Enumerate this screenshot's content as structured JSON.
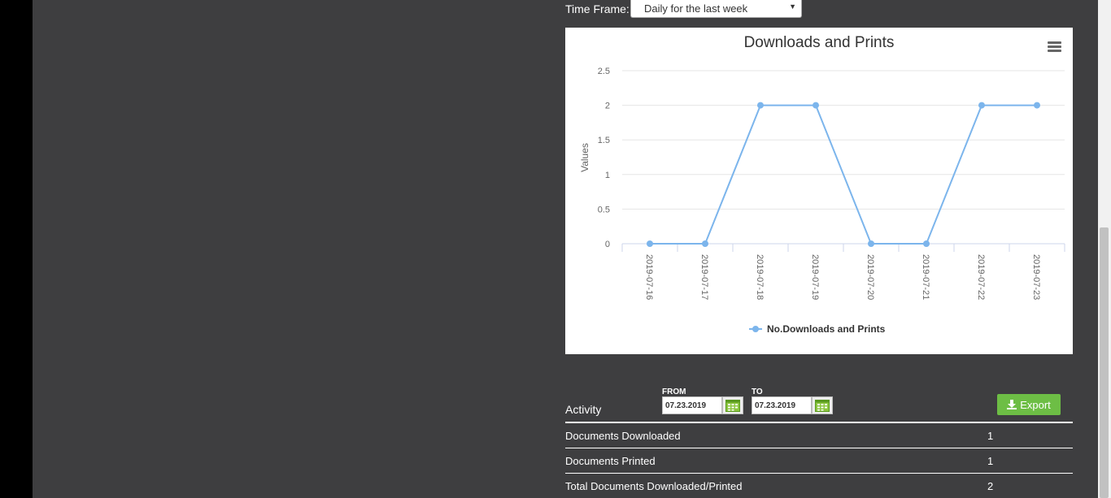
{
  "timeframe": {
    "label": "Time Frame:",
    "selected": "Daily for the last week"
  },
  "chart_data": {
    "type": "line",
    "title": "Downloads and Prints",
    "ylabel": "Values",
    "ylim": [
      0,
      2.5
    ],
    "yticks": [
      "0",
      "0.5",
      "1",
      "1.5",
      "2",
      "2.5"
    ],
    "categories": [
      "2019-07-16",
      "2019-07-17",
      "2019-07-18",
      "2019-07-19",
      "2019-07-20",
      "2019-07-21",
      "2019-07-22",
      "2019-07-23"
    ],
    "series": [
      {
        "name": "No.Downloads and Prints",
        "values": [
          0,
          0,
          2,
          2,
          0,
          0,
          2,
          2
        ]
      }
    ],
    "grid": true,
    "legend": "bottom-center",
    "color": "#7cb5ec"
  },
  "activity": {
    "heading": "Activity",
    "from_label": "FROM",
    "from_value": "07.23.2019",
    "to_label": "TO",
    "to_value": "07.23.2019",
    "export_label": "Export",
    "export_color": "#6dbe45",
    "rows": [
      {
        "label": "Documents Downloaded",
        "value": "1"
      },
      {
        "label": "Documents Printed",
        "value": "1"
      },
      {
        "label": "Total Documents Downloaded/Printed",
        "value": "2"
      }
    ]
  }
}
